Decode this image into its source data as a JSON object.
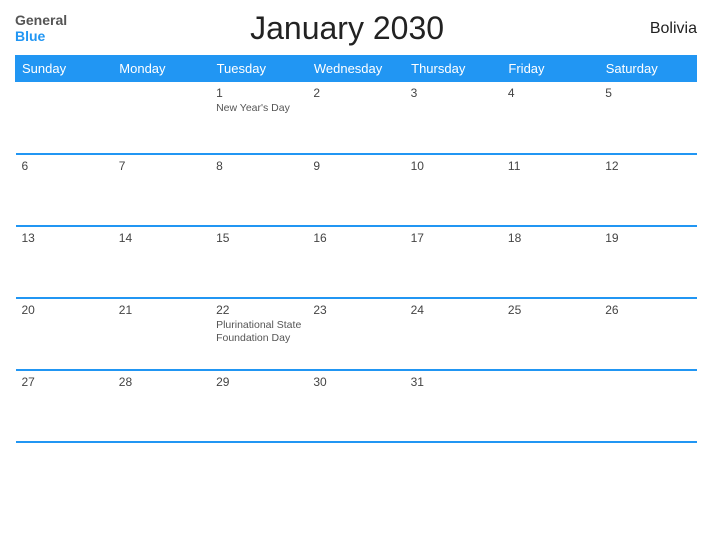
{
  "header": {
    "logo_line1": "General",
    "logo_line2": "Blue",
    "title": "January 2030",
    "country": "Bolivia"
  },
  "weekdays": [
    "Sunday",
    "Monday",
    "Tuesday",
    "Wednesday",
    "Thursday",
    "Friday",
    "Saturday"
  ],
  "weeks": [
    [
      {
        "day": "",
        "holiday": ""
      },
      {
        "day": "",
        "holiday": ""
      },
      {
        "day": "1",
        "holiday": "New Year's Day"
      },
      {
        "day": "2",
        "holiday": ""
      },
      {
        "day": "3",
        "holiday": ""
      },
      {
        "day": "4",
        "holiday": ""
      },
      {
        "day": "5",
        "holiday": ""
      }
    ],
    [
      {
        "day": "6",
        "holiday": ""
      },
      {
        "day": "7",
        "holiday": ""
      },
      {
        "day": "8",
        "holiday": ""
      },
      {
        "day": "9",
        "holiday": ""
      },
      {
        "day": "10",
        "holiday": ""
      },
      {
        "day": "11",
        "holiday": ""
      },
      {
        "day": "12",
        "holiday": ""
      }
    ],
    [
      {
        "day": "13",
        "holiday": ""
      },
      {
        "day": "14",
        "holiday": ""
      },
      {
        "day": "15",
        "holiday": ""
      },
      {
        "day": "16",
        "holiday": ""
      },
      {
        "day": "17",
        "holiday": ""
      },
      {
        "day": "18",
        "holiday": ""
      },
      {
        "day": "19",
        "holiday": ""
      }
    ],
    [
      {
        "day": "20",
        "holiday": ""
      },
      {
        "day": "21",
        "holiday": ""
      },
      {
        "day": "22",
        "holiday": "Plurinational State Foundation Day"
      },
      {
        "day": "23",
        "holiday": ""
      },
      {
        "day": "24",
        "holiday": ""
      },
      {
        "day": "25",
        "holiday": ""
      },
      {
        "day": "26",
        "holiday": ""
      }
    ],
    [
      {
        "day": "27",
        "holiday": ""
      },
      {
        "day": "28",
        "holiday": ""
      },
      {
        "day": "29",
        "holiday": ""
      },
      {
        "day": "30",
        "holiday": ""
      },
      {
        "day": "31",
        "holiday": ""
      },
      {
        "day": "",
        "holiday": ""
      },
      {
        "day": "",
        "holiday": ""
      }
    ]
  ]
}
